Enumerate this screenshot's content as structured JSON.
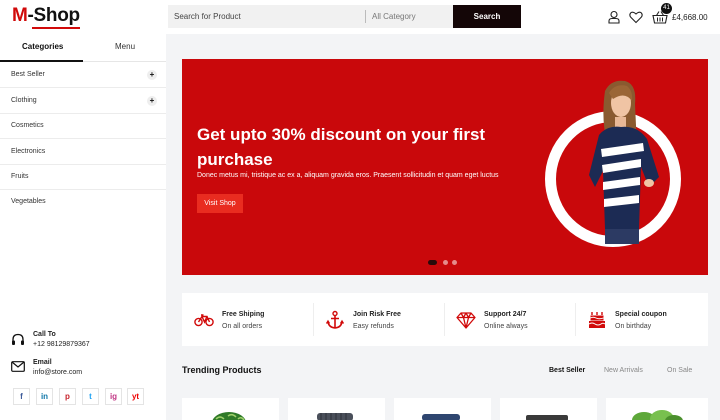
{
  "header": {
    "logo_initial": "M",
    "logo_rest": "-Shop",
    "search_placeholder": "Search for Product",
    "category": "All Category",
    "search_button": "Search",
    "cart_count": "41",
    "cart_total": "£4,668.00"
  },
  "sidebar": {
    "tabs": [
      "Categories",
      "Menu"
    ],
    "items": [
      {
        "label": "Best Seller",
        "expand": "+"
      },
      {
        "label": "Clothing",
        "expand": "+"
      },
      {
        "label": "Cosmetics"
      },
      {
        "label": "Electronics"
      },
      {
        "label": "Fruits"
      },
      {
        "label": "Vegetables"
      }
    ],
    "contact": {
      "call_label": "Call To",
      "call_value": "+12 98129879367",
      "email_label": "Email",
      "email_value": "info@store.com"
    },
    "social": [
      "f",
      "in",
      "p",
      "t",
      "ig",
      "yt"
    ]
  },
  "hero": {
    "title": "Get upto 30% discount on your first purchase",
    "description": "Donec metus mi, tristique ac ex a, aliquam gravida eros. Praesent sollicitudin et quam eget luctus",
    "button": "Visit Shop",
    "slides_total": 3,
    "slide_active": 1
  },
  "features": [
    {
      "icon": "bicycle-icon",
      "title": "Free Shiping",
      "subtitle": "On all orders"
    },
    {
      "icon": "anchor-icon",
      "title": "Join Risk Free",
      "subtitle": "Easy refunds"
    },
    {
      "icon": "diamond-icon",
      "title": "Support 24/7",
      "subtitle": "Online always"
    },
    {
      "icon": "cake-icon",
      "title": "Special coupon",
      "subtitle": "On birthday"
    }
  ],
  "trending": {
    "title": "Trending Products",
    "tabs": [
      "Best Seller",
      "New Arrivals",
      "On Sale"
    ],
    "active_tab": "Best Seller"
  },
  "colors": {
    "brand_red": "#d10a0a",
    "hero_bg": "#c9080b",
    "dark": "#140607"
  }
}
